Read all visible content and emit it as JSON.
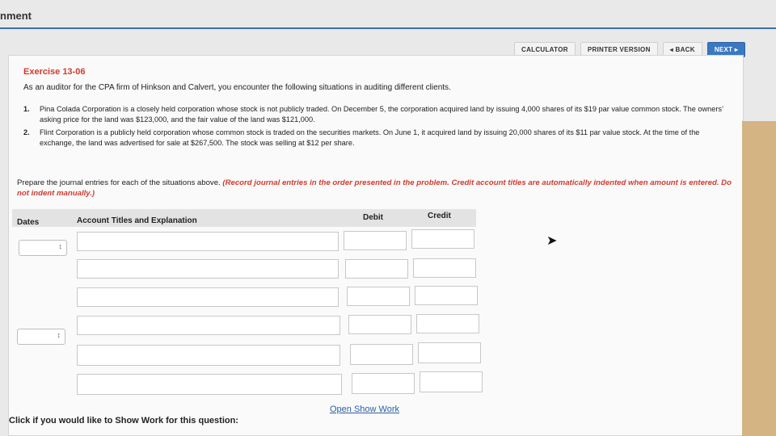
{
  "app": {
    "title": "nment"
  },
  "toolbar": {
    "calculator": "CALCULATOR",
    "printer": "PRINTER VERSION",
    "back": "◂ BACK",
    "next": "NEXT ▸"
  },
  "exercise": {
    "title": "Exercise 13-06",
    "intro": "As an auditor for the CPA firm of Hinkson and Calvert, you encounter the following situations in auditing different clients.",
    "items": [
      {
        "num": "1.",
        "text": "Pina Colada Corporation is a closely held corporation whose stock is not publicly traded. On December 5, the corporation acquired land by issuing 4,000 shares of its $19 par value common stock. The owners’ asking price for the land was $123,000, and the fair value of the land was $121,000."
      },
      {
        "num": "2.",
        "text": "Flint Corporation is a publicly held corporation whose common stock is traded on the securities markets. On June 1, it acquired land by issuing 20,000 shares of its $11 par value stock. At the time of the exchange, the land was advertised for sale at $267,500. The stock was selling at $12 per share."
      }
    ],
    "instruction_plain": "Prepare the journal entries for each of the situations above. ",
    "instruction_red": "(Record journal entries in the order presented in the problem. Credit account titles are automatically indented when amount is entered. Do not indent manually.)"
  },
  "table": {
    "headers": {
      "dates": "Dates",
      "account": "Account Titles and Explanation",
      "debit": "Debit",
      "credit": "Credit"
    }
  },
  "footer": {
    "prompt": "Click if you would like to Show Work for this question:",
    "link": "Open Show Work"
  }
}
